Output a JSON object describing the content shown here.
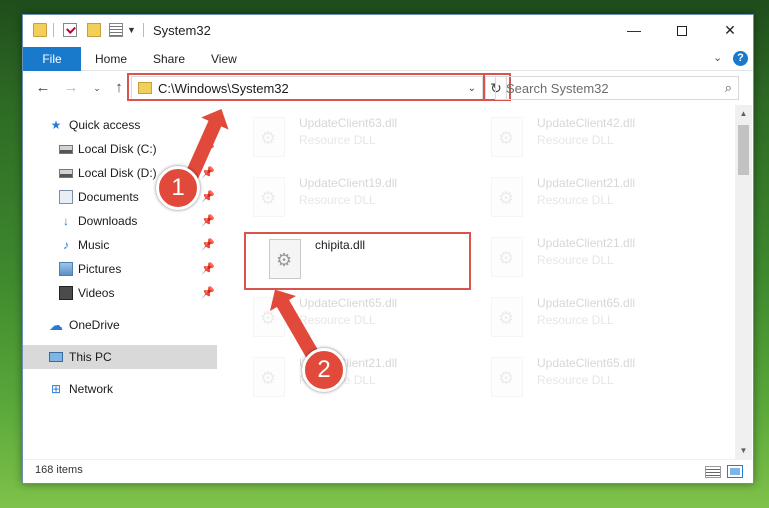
{
  "window": {
    "title": "System32",
    "controls": {
      "minimize": "—",
      "maximize": "",
      "close": "✕"
    }
  },
  "ribbon": {
    "tabs": [
      "File",
      "Home",
      "Share",
      "View"
    ],
    "help": "?"
  },
  "navigation": {
    "back": "←",
    "forward": "→",
    "recent": "⌄",
    "up": "↑"
  },
  "address": {
    "path": "C:\\Windows\\System32",
    "refresh": "↻"
  },
  "search": {
    "placeholder": "Search System32",
    "icon": "⌕"
  },
  "sidebar": {
    "items": [
      {
        "label": "Quick access",
        "icon": "star-icon",
        "pinned": false
      },
      {
        "label": "Local Disk (C:)",
        "icon": "drive-icon",
        "pinned": true
      },
      {
        "label": "Local Disk (D:)",
        "icon": "drive-icon",
        "pinned": true
      },
      {
        "label": "Documents",
        "icon": "documents-icon",
        "pinned": true
      },
      {
        "label": "Downloads",
        "icon": "download-icon",
        "pinned": true
      },
      {
        "label": "Music",
        "icon": "music-icon",
        "pinned": true
      },
      {
        "label": "Pictures",
        "icon": "pictures-icon",
        "pinned": true
      },
      {
        "label": "Videos",
        "icon": "videos-icon",
        "pinned": true
      },
      {
        "label": "OneDrive",
        "icon": "cloud-icon",
        "pinned": false
      },
      {
        "label": "This PC",
        "icon": "computer-icon",
        "pinned": false,
        "selected": true
      },
      {
        "label": "Network",
        "icon": "network-icon",
        "pinned": false
      }
    ],
    "pin_glyph": "📌"
  },
  "files": [
    {
      "name": "UpdateClient63.dll",
      "type": "Resource DLL",
      "faded": true
    },
    {
      "name": "UpdateClient42.dll",
      "type": "Resource DLL",
      "faded": true
    },
    {
      "name": "UpdateClient19.dll",
      "type": "Resource DLL",
      "faded": true
    },
    {
      "name": "UpdateClient21.dll",
      "type": "Resource DLL",
      "faded": true
    },
    {
      "name": "chipita.dll",
      "type": "",
      "faded": false
    },
    {
      "name": "UpdateClient21.dll",
      "type": "Resource DLL",
      "faded": true
    },
    {
      "name": "UpdateClient65.dll",
      "type": "Resource DLL",
      "faded": true
    },
    {
      "name": "UpdateClient65.dll",
      "type": "Resource DLL",
      "faded": true
    },
    {
      "name": "UpdateClient21.dll",
      "type": "Resource DLL",
      "faded": true
    },
    {
      "name": "UpdateClient65.dll",
      "type": "Resource DLL",
      "faded": true
    }
  ],
  "status": {
    "item_count": "168 items"
  },
  "callouts": {
    "one": "1",
    "two": "2"
  },
  "colors": {
    "accent": "#1979ca",
    "highlight": "#d9534f",
    "callout": "#e14a3b"
  }
}
